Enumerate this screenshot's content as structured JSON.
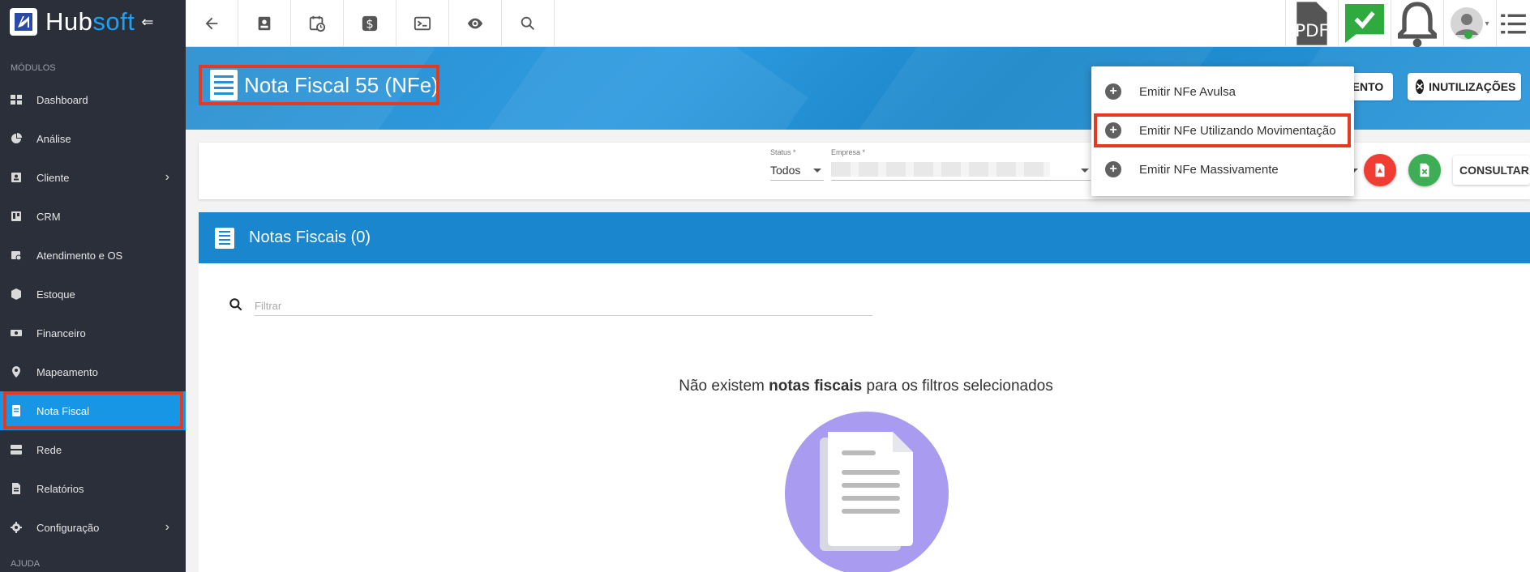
{
  "app": {
    "logo_part1": "Hub",
    "logo_part2": "soft"
  },
  "sidebar": {
    "section_modules": "MÓDULOS",
    "section_help": "AJUDA",
    "items": [
      {
        "label": "Dashboard",
        "icon": "dashboard-icon"
      },
      {
        "label": "Análise",
        "icon": "pie-chart-icon"
      },
      {
        "label": "Cliente",
        "icon": "contact-card-icon",
        "has_submenu": true
      },
      {
        "label": "CRM",
        "icon": "kanban-icon"
      },
      {
        "label": "Atendimento e OS",
        "icon": "calendar-clock-icon"
      },
      {
        "label": "Estoque",
        "icon": "box-icon"
      },
      {
        "label": "Financeiro",
        "icon": "money-icon"
      },
      {
        "label": "Mapeamento",
        "icon": "map-pin-icon"
      },
      {
        "label": "Nota Fiscal",
        "icon": "receipt-icon",
        "active": true
      },
      {
        "label": "Rede",
        "icon": "server-icon"
      },
      {
        "label": "Relatórios",
        "icon": "report-icon"
      },
      {
        "label": "Configuração",
        "icon": "gear-icon",
        "has_submenu": true
      }
    ]
  },
  "page": {
    "title": "Nota Fiscal 55 (NFe)"
  },
  "header_buttons": {
    "movimento_label": "MENTO",
    "inutilizacoes_label": "INUTILIZAÇÕES"
  },
  "filters": {
    "status_label": "Status *",
    "status_value": "Todos",
    "empresa_label": "Empresa *",
    "consultar_label": "CONSULTAR"
  },
  "panel": {
    "title": "Notas Fiscais (0)",
    "filter_placeholder": "Filtrar",
    "empty_prefix": "Não existem ",
    "empty_bold": "notas fiscais",
    "empty_suffix": " para os filtros selecionados"
  },
  "dropdown": {
    "items": [
      "Emitir NFe Avulsa",
      "Emitir NFe Utilizando Movimentação",
      "Emitir NFe Massivamente"
    ]
  },
  "colors": {
    "accent": "#1796e6",
    "highlight": "#e53a22",
    "sidebar_bg": "#2b2f3a",
    "header_blue": "#1a86cd"
  }
}
